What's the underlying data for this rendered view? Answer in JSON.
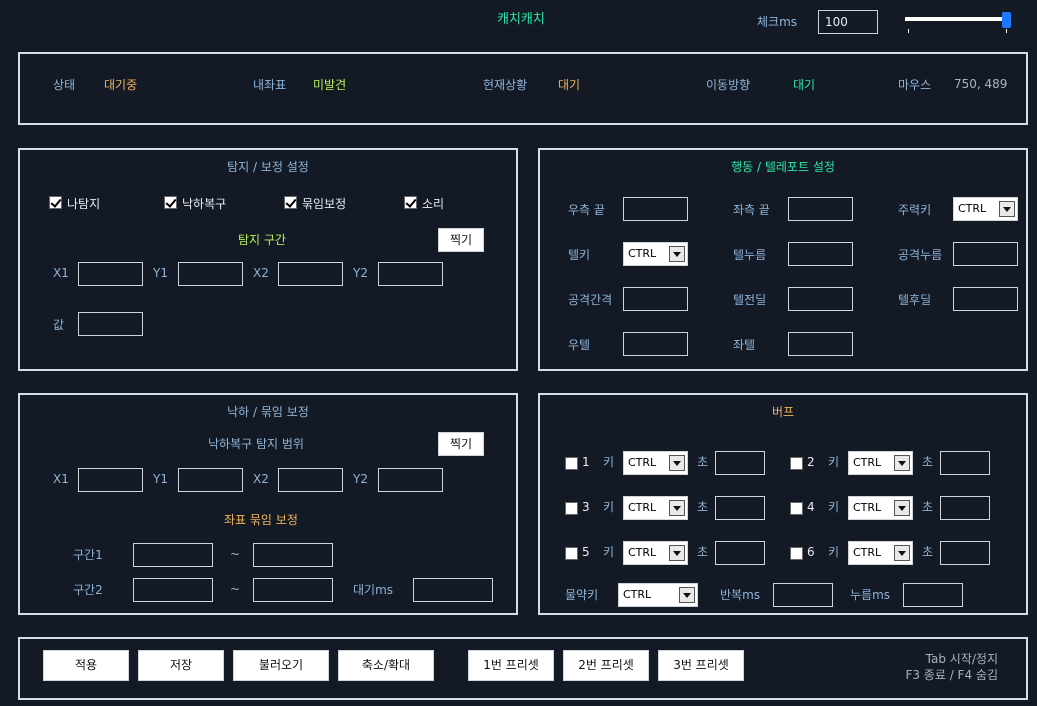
{
  "colors": {
    "accent_green": "#2ee6a6",
    "accent_orange": "#f2b35a",
    "label_blue": "#8fb4d8",
    "bg": "#131a26"
  },
  "app": {
    "title": "캐치캐치",
    "check_label": "체크ms",
    "check_value": "100",
    "slider_level": 1.0
  },
  "status": {
    "state_label": "상태",
    "state_value": "대기중",
    "mypos_label": "내좌표",
    "mypos_value": "미발견",
    "current_label": "현재상황",
    "current_value": "대기",
    "direction_label": "이동방향",
    "direction_value": "대기",
    "mouse_label": "마우스",
    "mouse_value": "750, 489"
  },
  "detect": {
    "title": "탐지 / 보정 설정",
    "checks": [
      {
        "label": "나탐지",
        "checked": true
      },
      {
        "label": "낙하복구",
        "checked": true
      },
      {
        "label": "묶임보정",
        "checked": true
      },
      {
        "label": "소리",
        "checked": true
      }
    ],
    "section_label": "탐지 구간",
    "capture_button": "찍기",
    "x1": "X1",
    "y1": "Y1",
    "x2": "X2",
    "y2": "Y2",
    "value_label": "값"
  },
  "action": {
    "title": "행동 / 텔레포트 설정",
    "right_end": "우측 끝",
    "left_end": "좌측 끝",
    "main_key": "주력키",
    "main_key_value": "CTRL",
    "tel_key": "텔키",
    "tel_key_value": "CTRL",
    "tel_press": "텔누름",
    "attack_press": "공격누름",
    "attack_interval": "공격간격",
    "tel_pre_delay": "텔전딜",
    "tel_post_delay": "텔후딜",
    "right_tel": "우텔",
    "left_tel": "좌텔"
  },
  "fall": {
    "title": "낙하 / 묶임 보정",
    "range_label": "낙하복구 탐지 범위",
    "capture_button": "찍기",
    "x1": "X1",
    "y1": "Y1",
    "x2": "X2",
    "y2": "Y2",
    "bind_label": "좌표 묶임 보정",
    "zone1": "구간1",
    "zone2": "구간2",
    "tilde": "~",
    "wait": "대기ms"
  },
  "buff": {
    "title": "버프",
    "key_label": "키",
    "sec_label": "초",
    "items": [
      {
        "num": "1",
        "key": "CTRL"
      },
      {
        "num": "2",
        "key": "CTRL"
      },
      {
        "num": "3",
        "key": "CTRL"
      },
      {
        "num": "4",
        "key": "CTRL"
      },
      {
        "num": "5",
        "key": "CTRL"
      },
      {
        "num": "6",
        "key": "CTRL"
      }
    ],
    "potion_label": "물약키",
    "potion_value": "CTRL",
    "repeat_label": "반복ms",
    "press_label": "누름ms"
  },
  "bottom": {
    "apply": "적용",
    "save": "저장",
    "load": "불러오기",
    "zoom": "축소/확대",
    "preset1": "1번 프리셋",
    "preset2": "2번 프리셋",
    "preset3": "3번 프리셋",
    "hint1": "Tab 시작/정지",
    "hint2": "F3 종료 / F4 숨김"
  }
}
